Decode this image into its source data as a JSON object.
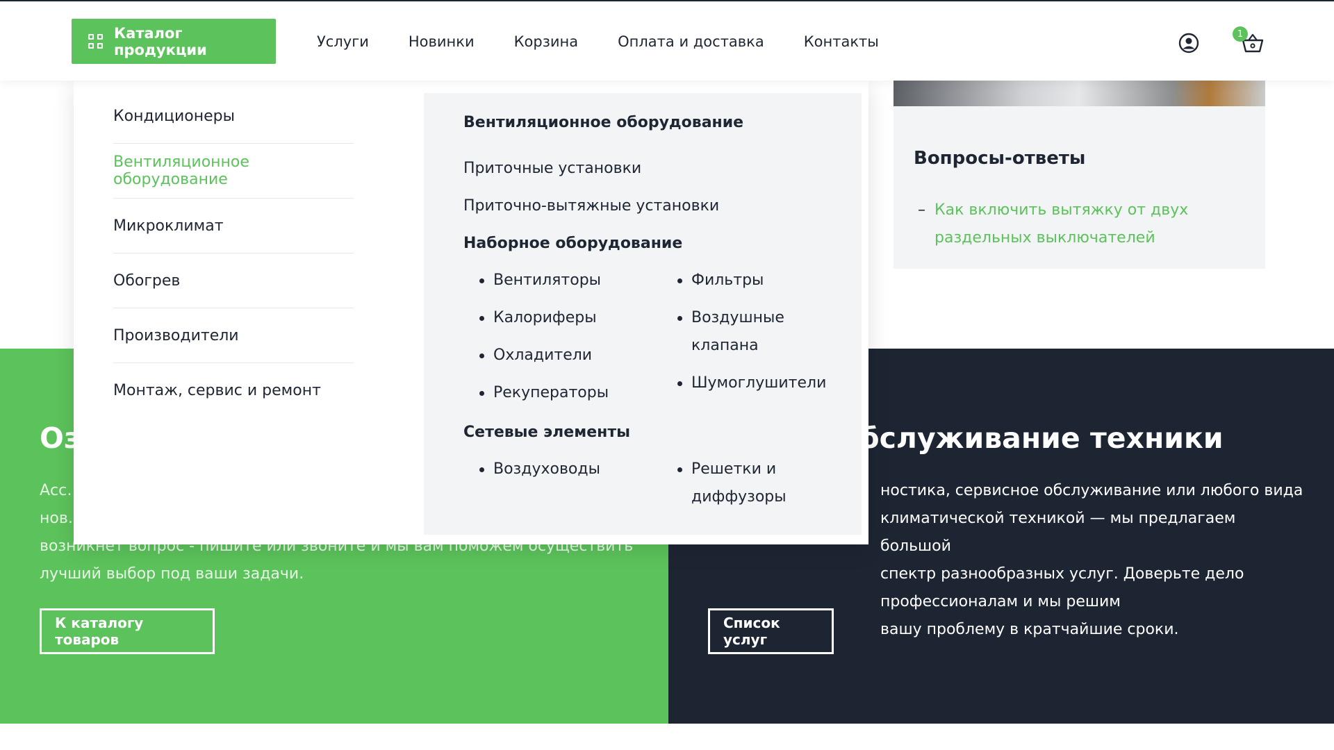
{
  "header": {
    "catalog_button": "Каталог продукции",
    "nav": [
      "Услуги",
      "Новинки",
      "Корзина",
      "Оплата и доставка",
      "Контакты"
    ],
    "cart_count": "1"
  },
  "dropdown": {
    "categories": [
      "Кондиционеры",
      "Вентиляционное оборудование",
      "Микроклимат",
      "Обогрев",
      "Производители",
      "Монтаж, сервис и ремонт"
    ],
    "panel": {
      "title": "Вентиляционное оборудование",
      "links": [
        "Приточные установки",
        "Приточно-вытяжные установки"
      ],
      "group1": {
        "title": "Наборное оборудование",
        "col1": [
          "Вентиляторы",
          "Калориферы",
          "Охладители",
          "Рекуператоры"
        ],
        "col2": [
          "Фильтры",
          "Воздушные клапана",
          "Шумоглушители"
        ]
      },
      "group2": {
        "title": "Сетевые элементы",
        "col1": [
          "Воздуховоды"
        ],
        "col2": [
          "Решетки и диффузоры"
        ]
      }
    }
  },
  "faq": {
    "title": "Вопросы-ответы",
    "dash": "–",
    "item": "Как включить вытяжку от двух раздельных выключателей"
  },
  "banner_left": {
    "title": "Оз",
    "text": "Асс…\nнов…\nвозникнет вопрос - пишите или звоните и мы вам поможем осуществить\nлучший выбор под ваши задачи.",
    "button": "К каталогу товаров"
  },
  "banner_right": {
    "title": "бслуживание техники",
    "text": "ностика, сервисное обслуживание или любого вида\nклиматической техникой — мы предлагаем большой\nспектр разнообразных услуг. Доверьте дело профессионалам и мы решим\nвашу проблему в кратчайшие сроки.",
    "button": "Список услуг"
  },
  "colors": {
    "accent": "#5cc25b",
    "dark": "#1d2533",
    "panel": "#f3f4f5",
    "text": "#1f2633"
  }
}
